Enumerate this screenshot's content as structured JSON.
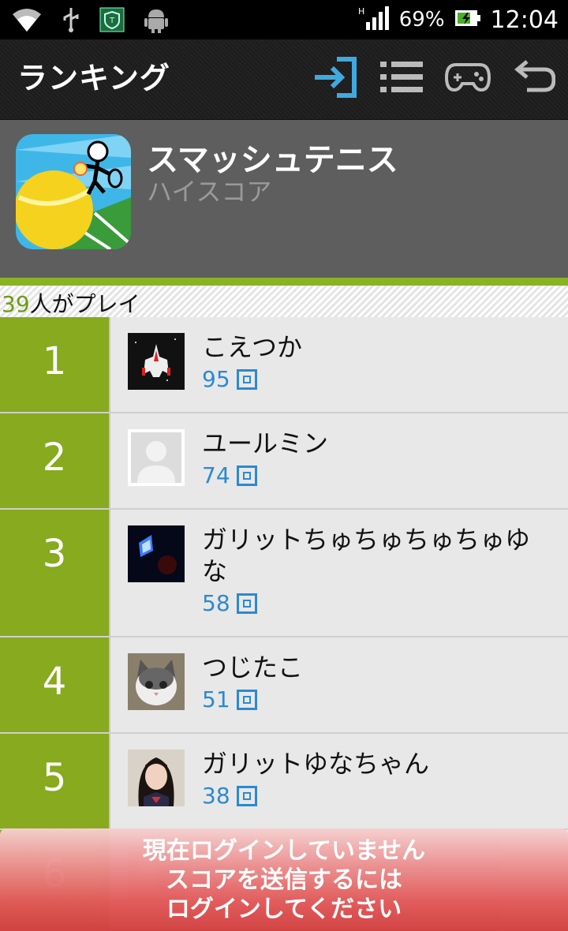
{
  "status_bar": {
    "battery_percent": "69%",
    "time": "12:04",
    "icons": [
      "wifi-icon",
      "usb-icon",
      "shield-icon",
      "android-icon",
      "signal-icon",
      "battery-icon"
    ]
  },
  "action_bar": {
    "title": "ランキング",
    "icons": [
      "login-icon",
      "list-icon",
      "gamepad-icon",
      "back-icon"
    ],
    "accent": "#3fa9e0"
  },
  "game": {
    "title": "スマッシュテニス",
    "subtitle": "ハイスコア"
  },
  "players": {
    "count": "39",
    "suffix": "人がプレイ"
  },
  "ranking": [
    {
      "rank": "1",
      "name": "こえつか",
      "score": "95"
    },
    {
      "rank": "2",
      "name": "ユールミン",
      "score": "74"
    },
    {
      "rank": "3",
      "name": "ガリットちゅちゅちゅちゅゆな",
      "score": "58"
    },
    {
      "rank": "4",
      "name": "つじたこ",
      "score": "51"
    },
    {
      "rank": "5",
      "name": "ガリットゆなちゃん",
      "score": "38"
    },
    {
      "rank": "6",
      "name": "",
      "score": ""
    }
  ],
  "login_notice": {
    "line1": "現在ログインしていません",
    "line2": "スコアを送信するには",
    "line3": "ログインしてください"
  },
  "colors": {
    "rank_green": "#87aa1e",
    "score_blue": "#2b8ad0",
    "banner_red": "#e25a5a"
  }
}
